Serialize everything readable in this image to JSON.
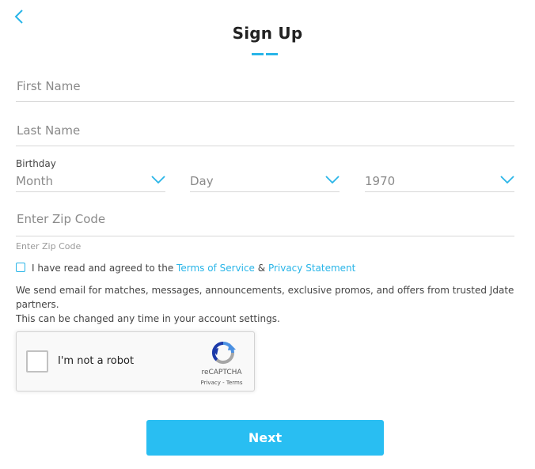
{
  "header": {
    "title": "Sign Up",
    "back_icon": "chevron-left-icon"
  },
  "form": {
    "first_name": {
      "placeholder": "First Name",
      "value": ""
    },
    "last_name": {
      "placeholder": "Last Name",
      "value": ""
    },
    "birthday": {
      "label": "Birthday",
      "month": {
        "value": "Month",
        "icon": "chevron-down-icon"
      },
      "day": {
        "value": "Day",
        "icon": "chevron-down-icon"
      },
      "year": {
        "value": "1970",
        "icon": "chevron-down-icon"
      }
    },
    "zip": {
      "placeholder": "Enter Zip Code",
      "value": "",
      "hint": "Enter Zip Code"
    },
    "agree": {
      "checked": false,
      "prefix": "I have read and agreed to the ",
      "terms_link": "Terms of Service",
      "amp": " & ",
      "privacy_link": "Privacy Statement"
    },
    "info_line1": "We send email for matches, messages, announcements, exclusive promos, and offers from trusted Jdate partners.",
    "info_line2": "This can be changed any time in your account settings."
  },
  "recaptcha": {
    "label": "I'm not a robot",
    "brand": "reCAPTCHA",
    "privacy": "Privacy",
    "separator": " - ",
    "terms": "Terms"
  },
  "actions": {
    "next_label": "Next"
  },
  "colors": {
    "accent": "#29b5e8",
    "button": "#29bef2"
  }
}
